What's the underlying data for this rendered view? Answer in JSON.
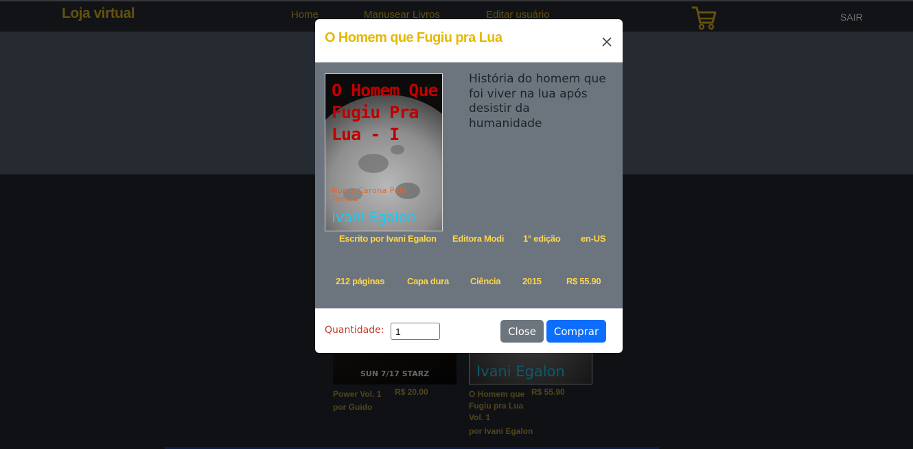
{
  "navbar": {
    "brand": "Loja virtual",
    "links": [
      "Home",
      "Manusear Livros",
      "Editar usuário"
    ],
    "cart_icon": "cart-icon",
    "logout": "SAIR"
  },
  "books": [
    {
      "title": "Power Vol. 1",
      "author": "por Guido",
      "price": "R$ 20.00",
      "cover_text": "SUN 7/17 STARZ"
    },
    {
      "title": "O Homem que Fugiu pra Lua Vol. 1",
      "author": "por Ivani Egalon",
      "price": "R$ 55.90",
      "cover_text": "Ivani Egalon"
    }
  ],
  "modal": {
    "title": "O Homem que Fugiu pra Lua",
    "close_icon": "close-icon",
    "cover": {
      "title": "O Homem Que Fugiu Pra Lua - I",
      "subtitle": "Numa Carona Pelo Tempo",
      "author": "Ivani Egalon"
    },
    "description": "História do homem que foi viver na lua após desistir da humanidade",
    "meta_row1": [
      "Escrito por Ivani Egalon",
      "Editora Modi",
      "1° edição",
      "en-US"
    ],
    "meta_row2": [
      "212 páginas",
      "Capa dura",
      "Ciência",
      "2015",
      "R$ 55.90"
    ],
    "quantity_label": "Quantidade:",
    "quantity_value": "1",
    "close_button": "Close",
    "buy_button": "Comprar"
  },
  "colors": {
    "accent": "#e5b800",
    "brand": "#c9a21a",
    "primary": "#0d6efd",
    "secondary": "#6c757d"
  }
}
